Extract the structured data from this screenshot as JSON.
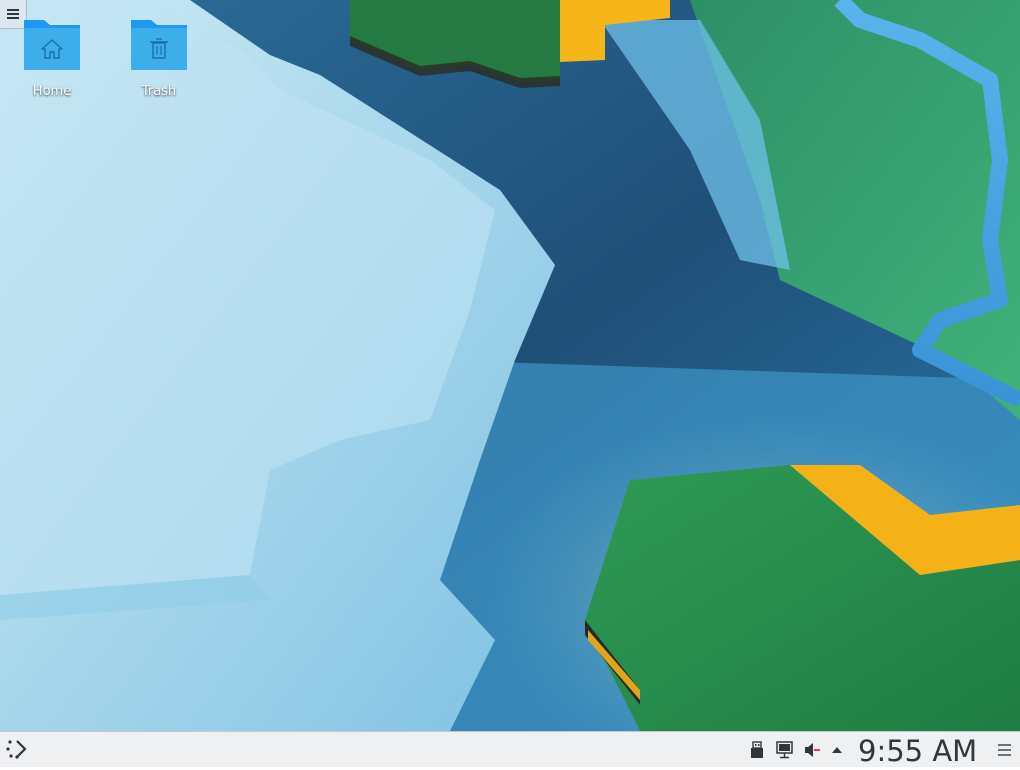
{
  "desktop": {
    "icons": [
      {
        "label": "Home",
        "glyph": "home-icon"
      },
      {
        "label": "Trash",
        "glyph": "trash-icon"
      }
    ],
    "toolbox_icon": "hamburger-menu-icon"
  },
  "taskbar": {
    "launcher_icon": "application-launcher-icon",
    "tray_icons": [
      "usb-device-icon",
      "network-wired-icon",
      "volume-muted-icon",
      "expand-up-arrow-icon"
    ],
    "clock": "9:55 AM",
    "panel_menu_icon": "panel-options-icon"
  },
  "colors": {
    "folder_blue": "#3daee9",
    "panel_bg": "#eff0f1",
    "text_dark": "#31363b",
    "muted_red": "#da4453"
  }
}
